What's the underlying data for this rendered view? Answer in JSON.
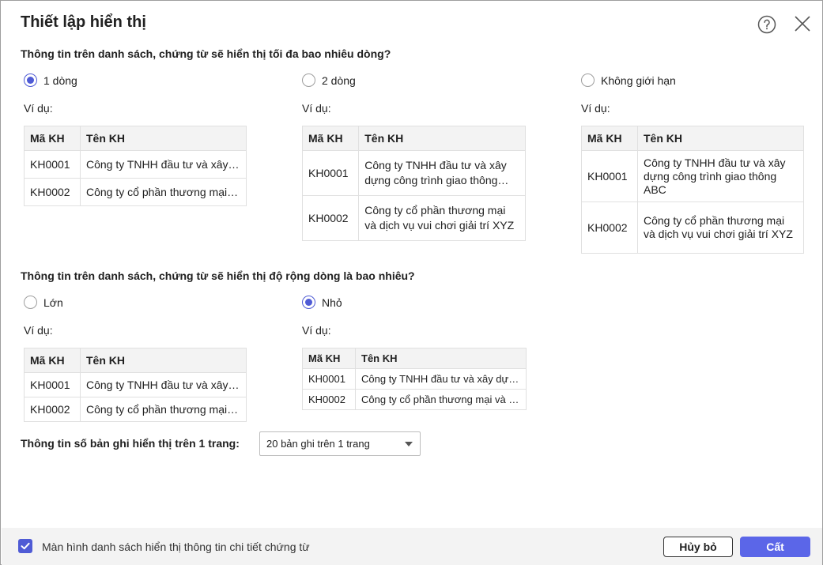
{
  "dialog": {
    "title": "Thiết lập hiển thị"
  },
  "lines_section": {
    "question": "Thông tin trên danh sách, chứng từ sẽ hiển thị tối đa bao nhiêu dòng?",
    "options": [
      {
        "label": "1 dòng",
        "checked": true
      },
      {
        "label": "2 dòng",
        "checked": false
      },
      {
        "label": "Không giới hạn",
        "checked": false
      }
    ]
  },
  "width_section": {
    "question": "Thông tin trên danh sách, chứng từ sẽ hiển thị độ rộng dòng là bao nhiêu?",
    "options": [
      {
        "label": "Lớn",
        "checked": false
      },
      {
        "label": "Nhỏ",
        "checked": true
      }
    ]
  },
  "example": {
    "label": "Ví dụ:",
    "headers": [
      "Mã KH",
      "Tên KH"
    ],
    "rows": [
      {
        "code": "KH0001",
        "name": "Công ty TNHH đầu tư và xây dựng công trình giao thông ABC"
      },
      {
        "code": "KH0002",
        "name": "Công ty cổ phần thương mại và dịch vụ vui chơi giải trí XYZ"
      }
    ]
  },
  "page_size": {
    "label": "Thông tin số bản ghi hiển thị trên 1 trang:",
    "selected": "20 bản ghi trên 1 trang"
  },
  "footer": {
    "detail_checkbox_label": "Màn hình danh sách hiển thị thông tin chi tiết chứng từ",
    "detail_checked": true,
    "cancel_label": "Hủy bỏ",
    "save_label": "Cất"
  },
  "colors": {
    "accent": "#4f5bd5",
    "primary_button": "#5b66e8",
    "header_bg": "#f3f3f3"
  }
}
